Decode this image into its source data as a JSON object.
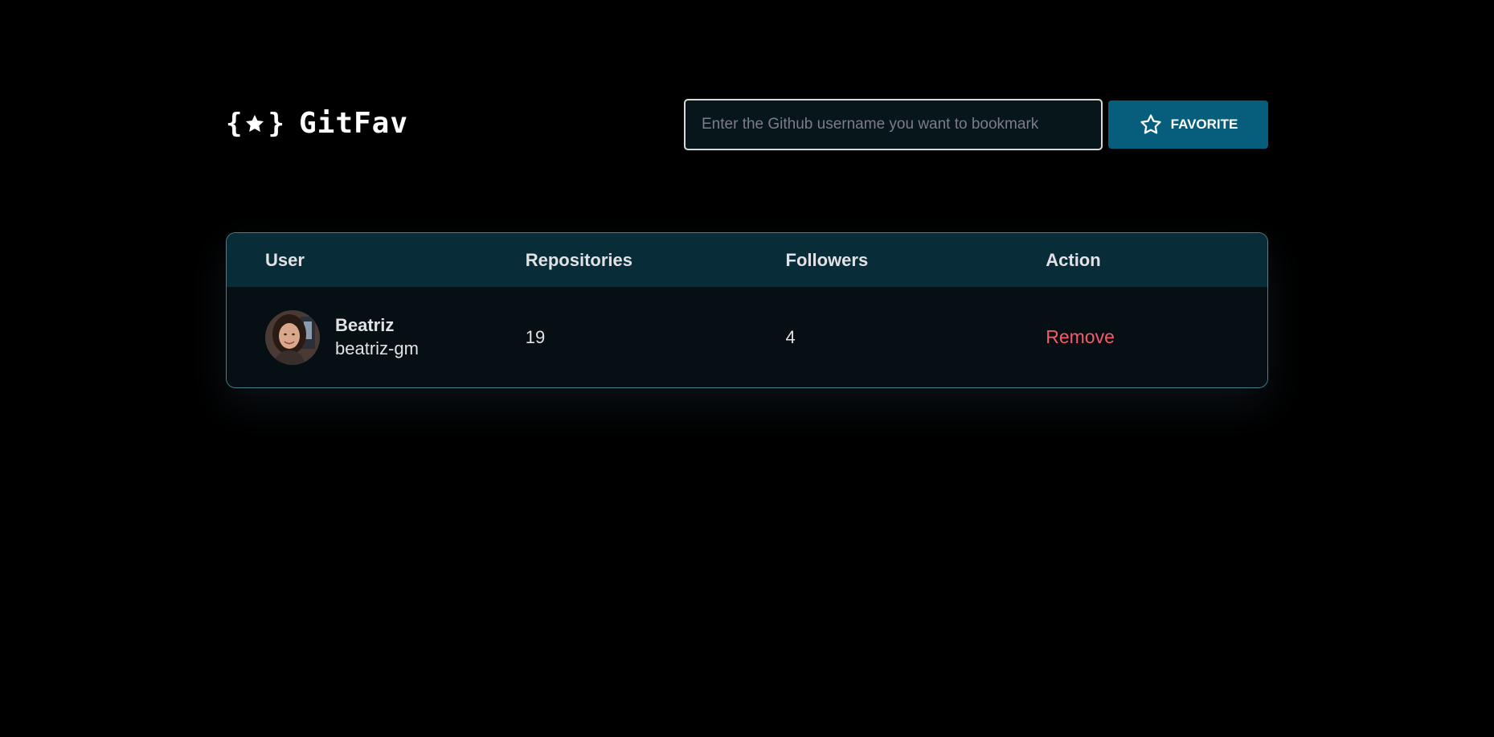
{
  "app": {
    "title": "GitFav",
    "logo_icon": "star-braces-icon"
  },
  "search": {
    "placeholder": "Enter the Github username you want to bookmark",
    "value": ""
  },
  "favorite_button": {
    "label": "FAVORITE",
    "icon": "star-outline-icon"
  },
  "table": {
    "columns": [
      "User",
      "Repositories",
      "Followers",
      "Action"
    ],
    "rows": [
      {
        "name": "Beatriz",
        "login": "beatriz-gm",
        "repositories": "19",
        "followers": "4",
        "action": "Remove",
        "avatar_icon": "user-avatar"
      }
    ]
  },
  "colors": {
    "background": "#000000",
    "accent": "#065e7c",
    "header_row": "#092d38",
    "body_row": "#060f14",
    "danger": "#f75a68"
  }
}
